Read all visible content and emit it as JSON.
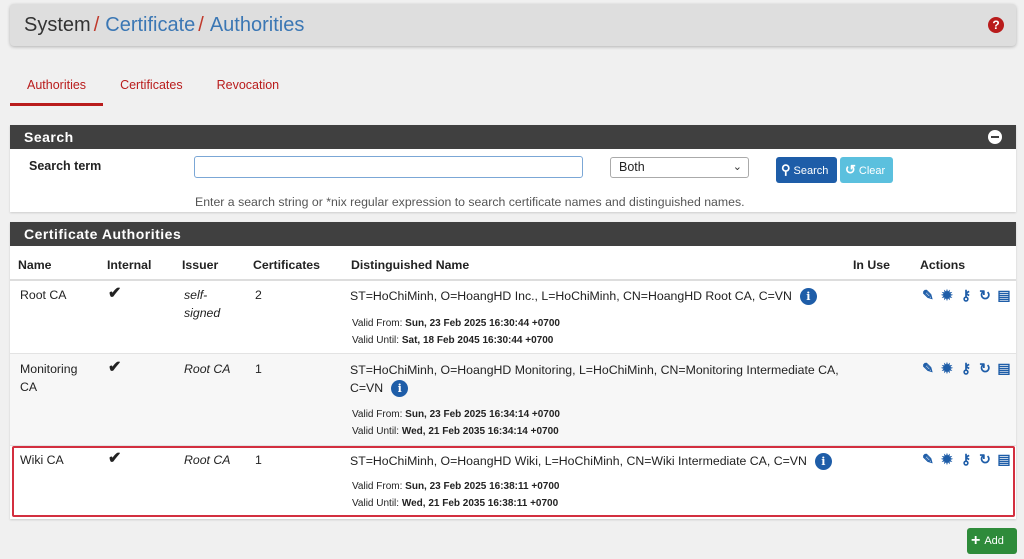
{
  "breadcrumb": {
    "root": "System",
    "sep": "/",
    "level1": "Certificate",
    "level2": "Authorities"
  },
  "help_icon": "question-circle-icon",
  "tabs": [
    {
      "label": "Authorities",
      "active": true
    },
    {
      "label": "Certificates",
      "active": false
    },
    {
      "label": "Revocation",
      "active": false
    }
  ],
  "search": {
    "title": "Search",
    "term_label": "Search term",
    "term_value": "",
    "scope_selected": "Both",
    "search_button": "Search",
    "clear_button": "Clear",
    "hint": "Enter a search string or *nix regular expression to search certificate names and distinguished names."
  },
  "ca_table": {
    "title": "Certificate Authorities",
    "headers": {
      "name": "Name",
      "internal": "Internal",
      "issuer": "Issuer",
      "certificates": "Certificates",
      "dn": "Distinguished Name",
      "in_use": "In Use",
      "actions": "Actions"
    },
    "rows": [
      {
        "name": "Root CA",
        "internal": "✔",
        "issuer_line1": "self-",
        "issuer_line2": "signed",
        "certificates": "2",
        "dn": "ST=HoChiMinh, O=HoangHD Inc., L=HoChiMinh, CN=HoangHD Root CA, C=VN",
        "valid_from_label": "Valid From:",
        "valid_from": "Sun, 23 Feb 2025 16:30:44 +0700",
        "valid_until_label": "Valid Until:",
        "valid_until": "Sat, 18 Feb 2045 16:30:44 +0700"
      },
      {
        "name_line1": "Monitoring",
        "name_line2": "CA",
        "internal": "✔",
        "issuer": "Root CA",
        "certificates": "1",
        "dn": "ST=HoChiMinh, O=HoangHD Monitoring, L=HoChiMinh, CN=Monitoring Intermediate CA, C=VN",
        "valid_from_label": "Valid From:",
        "valid_from": "Sun, 23 Feb 2025 16:34:14 +0700",
        "valid_until_label": "Valid Until:",
        "valid_until": "Wed, 21 Feb 2035 16:34:14 +0700"
      },
      {
        "name": "Wiki CA",
        "internal": "✔",
        "issuer": "Root CA",
        "certificates": "1",
        "dn": "ST=HoChiMinh, O=HoangHD Wiki, L=HoChiMinh, CN=Wiki Intermediate CA, C=VN",
        "valid_from_label": "Valid From:",
        "valid_from": "Sun, 23 Feb 2025 16:38:11 +0700",
        "valid_until_label": "Valid Until:",
        "valid_until": "Wed, 21 Feb 2035 16:38:11 +0700",
        "highlighted": true
      }
    ],
    "action_icons": [
      "pencil-icon",
      "gear-icon",
      "key-icon",
      "renew-icon",
      "trash-icon"
    ]
  },
  "add_button": "Add",
  "colors": {
    "accent_red": "#b91c1c",
    "panel_head": "#404040",
    "primary_blue": "#1e5da8",
    "info_blue": "#5bc0de",
    "success_green": "#2e8b3a",
    "highlight_border": "#d32f3f"
  }
}
